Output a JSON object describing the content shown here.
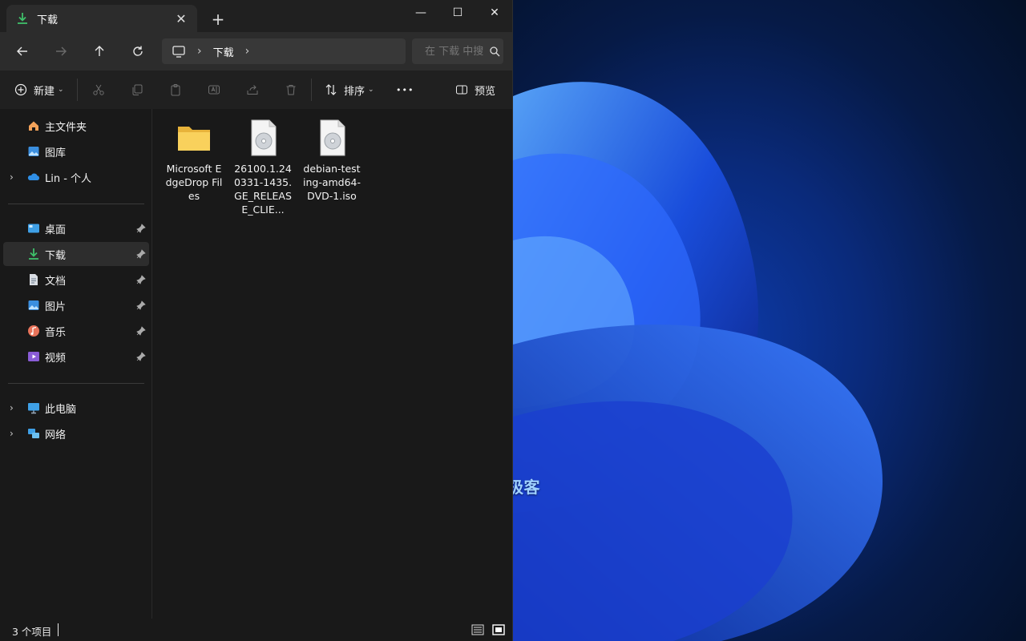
{
  "window": {
    "tab_title": "下载",
    "close_tab": "✕",
    "new_tab": "+",
    "minimize": "—",
    "maximize": "☐",
    "close": "✕"
  },
  "nav": {
    "breadcrumb": [
      "下载"
    ],
    "search_placeholder": "在 下载 中搜索"
  },
  "toolbar": {
    "new_label": "新建",
    "sort_label": "排序",
    "more_label": "•••",
    "preview_label": "预览"
  },
  "sidebar": {
    "quick": [
      {
        "label": "主文件夹",
        "icon": "home-icon"
      },
      {
        "label": "图库",
        "icon": "gallery-icon"
      },
      {
        "label": "Lin - 个人",
        "icon": "onedrive-icon"
      }
    ],
    "pinned": [
      {
        "label": "桌面",
        "icon": "desktop-icon"
      },
      {
        "label": "下载",
        "icon": "download-icon"
      },
      {
        "label": "文档",
        "icon": "documents-icon"
      },
      {
        "label": "图片",
        "icon": "pictures-icon"
      },
      {
        "label": "音乐",
        "icon": "music-icon"
      },
      {
        "label": "视频",
        "icon": "videos-icon"
      }
    ],
    "devices": [
      {
        "label": "此电脑",
        "icon": "this-pc-icon"
      },
      {
        "label": "网络",
        "icon": "network-icon"
      }
    ]
  },
  "files": [
    {
      "name": "Microsoft EdgeDrop Files",
      "type": "folder"
    },
    {
      "name": "26100.1.240331-1435.GE_RELEASE_CLIE...",
      "type": "iso"
    },
    {
      "name": "debian-testing-amd64-DVD-1.iso",
      "type": "iso"
    }
  ],
  "status": {
    "count": "3 个项目"
  },
  "watermark": "系统极客",
  "colors": {
    "accent": "#4cc2ff",
    "download_green": "#3fbf6a",
    "folder_yellow": "#f9d15c"
  }
}
